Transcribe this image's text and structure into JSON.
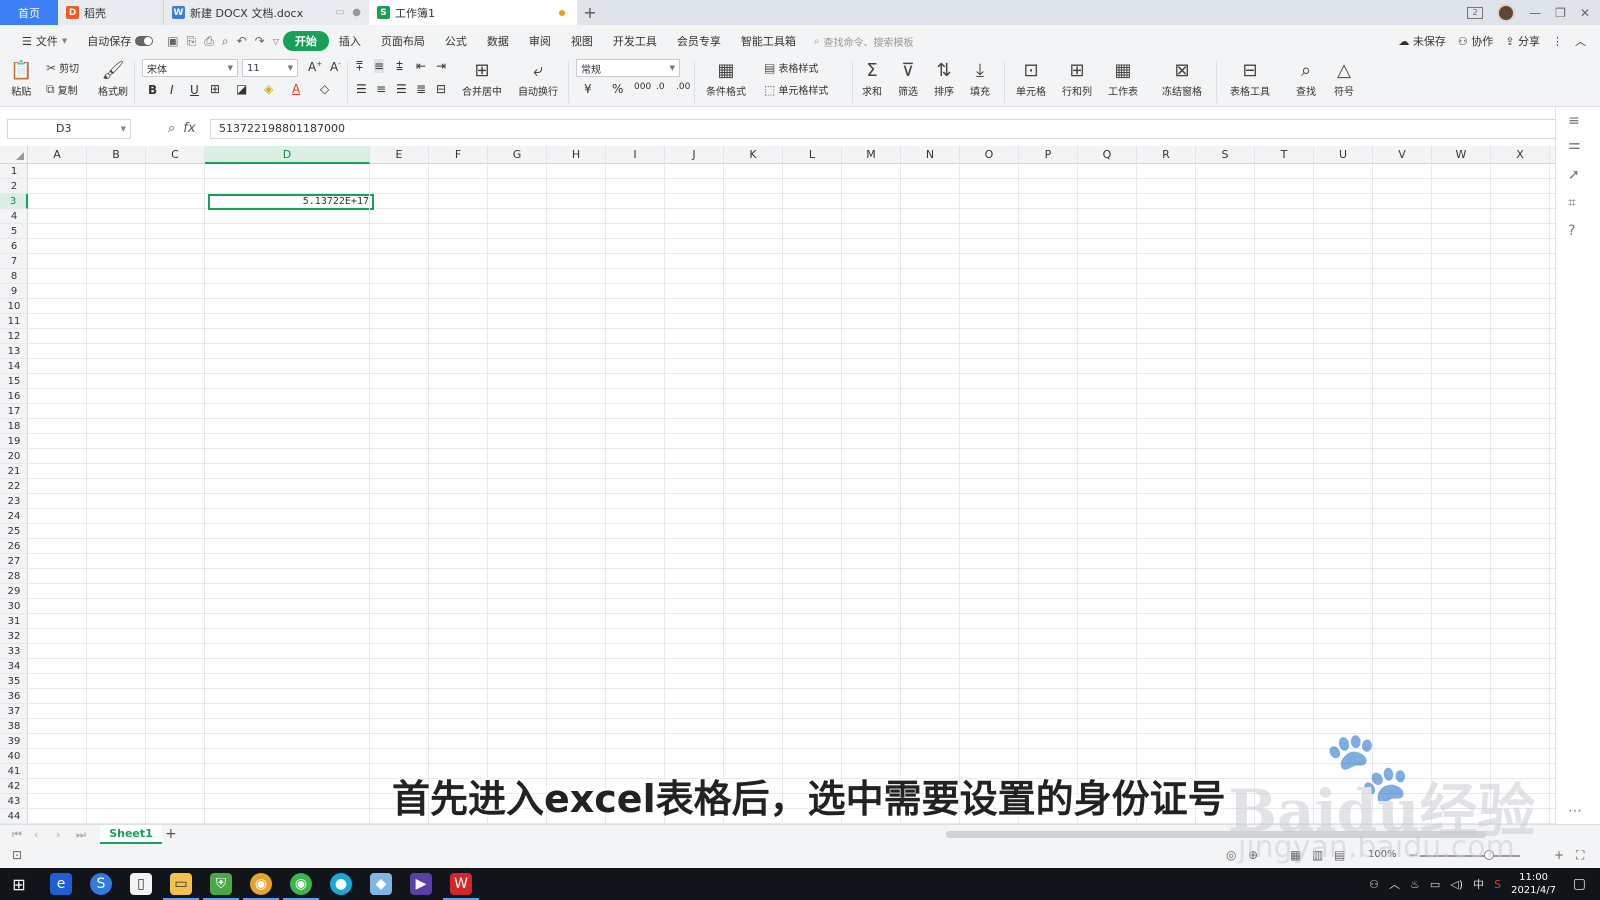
{
  "tabs": {
    "home": "首页",
    "daoke": "稻壳",
    "doc": "新建 DOCX 文档.docx",
    "sheet": "工作簿1"
  },
  "menu": {
    "file": "文件",
    "autosave": "自动保存",
    "items": [
      "开始",
      "插入",
      "页面布局",
      "公式",
      "数据",
      "审阅",
      "视图",
      "开发工具",
      "会员专享",
      "智能工具箱"
    ],
    "search_placeholder": "查找命令、搜索模板",
    "unsaved": "未保存",
    "collaborate": "协作",
    "share": "分享"
  },
  "ribbon": {
    "paste": "粘贴",
    "cut": "剪切",
    "copy": "复制",
    "format_painter": "格式刷",
    "font_name": "宋体",
    "font_size": "11",
    "merge_center": "合并居中",
    "auto_wrap": "自动换行",
    "number_format": "常规",
    "conditional_format": "条件格式",
    "table_style": "表格样式",
    "cell_style": "单元格样式",
    "sum": "求和",
    "filter": "筛选",
    "sort": "排序",
    "fill": "填充",
    "cell": "单元格",
    "row_col": "行和列",
    "worksheet": "工作表",
    "freeze": "冻结窗格",
    "table_tools": "表格工具",
    "find": "查找",
    "symbol": "符号"
  },
  "formula_bar": {
    "name_box": "D3",
    "formula": "513722198801187000"
  },
  "grid": {
    "columns": [
      "A",
      "B",
      "C",
      "D",
      "E",
      "F",
      "G",
      "H",
      "I",
      "J",
      "K",
      "L",
      "M",
      "N",
      "O",
      "P",
      "Q",
      "R",
      "S",
      "T",
      "U",
      "V",
      "W",
      "X"
    ],
    "selected_column": "D",
    "selected_row": 3,
    "row_count": 44,
    "active_cell_display": "5.13722E+17"
  },
  "sheet_tab": "Sheet1",
  "status": {
    "zoom": "100%"
  },
  "subtitle": "首先进入excel表格后，选中需要设置的身份证号",
  "watermark": {
    "brand": "Baidu经验",
    "url": "jingyan.baidu.com"
  },
  "taskbar": {
    "ime": "中",
    "time": "11:00",
    "date": "2021/4/7"
  }
}
